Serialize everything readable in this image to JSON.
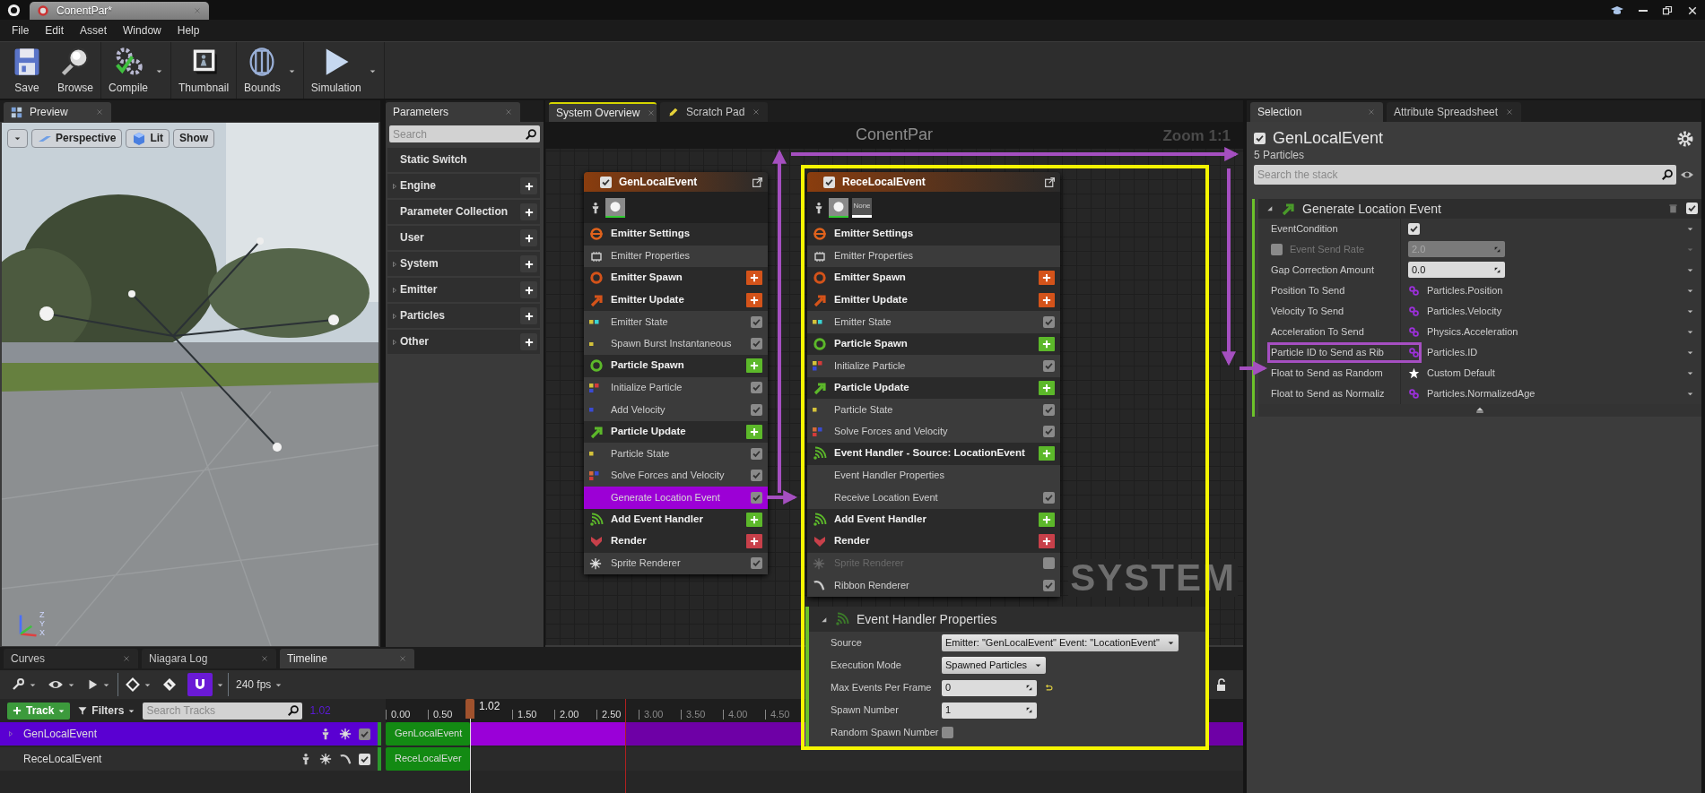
{
  "app_tab": {
    "title": "ConentPar*"
  },
  "menu": [
    "File",
    "Edit",
    "Asset",
    "Window",
    "Help"
  ],
  "toolbar": [
    {
      "label": "Save",
      "kind": "save",
      "dropdown": false
    },
    {
      "label": "Browse",
      "kind": "browse",
      "dropdown": false
    },
    {
      "label": "Compile",
      "kind": "compile",
      "dropdown": true
    },
    {
      "label": "Thumbnail",
      "kind": "thumbnail",
      "dropdown": false
    },
    {
      "label": "Bounds",
      "kind": "bounds",
      "dropdown": true
    },
    {
      "label": "Simulation",
      "kind": "simulation",
      "dropdown": true
    }
  ],
  "preview": {
    "tab": "Preview",
    "buttons": [
      {
        "label": "Perspective",
        "kind": "perspective"
      },
      {
        "label": "Lit",
        "kind": "lit"
      },
      {
        "label": "Show",
        "kind": "show"
      }
    ],
    "axes": [
      "Z",
      "Y",
      "X"
    ]
  },
  "parameters": {
    "tab": "Parameters",
    "placeholder": "Search",
    "items": [
      {
        "label": "Static Switch",
        "expandable": false,
        "addable": false
      },
      {
        "label": "Engine",
        "expandable": true,
        "addable": true
      },
      {
        "label": "Parameter Collection",
        "expandable": false,
        "addable": true
      },
      {
        "label": "User",
        "expandable": false,
        "addable": true
      },
      {
        "label": "System",
        "expandable": true,
        "addable": true
      },
      {
        "label": "Emitter",
        "expandable": true,
        "addable": true
      },
      {
        "label": "Particles",
        "expandable": true,
        "addable": true
      },
      {
        "label": "Other",
        "expandable": true,
        "addable": true
      }
    ]
  },
  "graph": {
    "tabs": [
      {
        "label": "System Overview",
        "kind": "overview",
        "selected": true
      },
      {
        "label": "Scratch Pad",
        "kind": "scratch",
        "selected": false
      }
    ],
    "title": "ConentPar",
    "zoom": "Zoom 1:1",
    "watermark": "SYSTEM",
    "nodes": [
      {
        "title": "GenLocalEvent",
        "enabled": true,
        "rows": [
          {
            "label": "Emitter Settings",
            "kind": "settings",
            "selected": false
          },
          {
            "label": "Emitter Properties",
            "kind": "properties",
            "selected": false
          },
          {
            "label": "Emitter Spawn",
            "kind": "spawn",
            "color": "#d4531a",
            "selected": false
          },
          {
            "label": "Emitter Update",
            "kind": "update",
            "color": "#d4531a",
            "selected": false
          },
          {
            "label": "Emitter State",
            "kind": "module",
            "dots": [
              {
                "color": "#d4c23a"
              },
              {
                "color": "#3ad4d4"
              }
            ],
            "enabled": true,
            "selected": false
          },
          {
            "label": "Spawn Burst Instantaneous",
            "kind": "module",
            "dots": [
              {
                "color": "#d4c23a"
              }
            ],
            "enabled": true,
            "selected": false
          },
          {
            "label": "Particle Spawn",
            "kind": "spawn",
            "color": "#5cb82a",
            "selected": false
          },
          {
            "label": "Initialize Particle",
            "kind": "module",
            "dots": [
              {
                "color": "#d4c23a"
              },
              {
                "color": "#d43a3a"
              },
              {
                "color": "#3a4ad4"
              }
            ],
            "enabled": true,
            "selected": false
          },
          {
            "label": "Add Velocity",
            "kind": "module",
            "dots": [
              {
                "color": "#3a4ad4"
              }
            ],
            "enabled": true,
            "selected": false
          },
          {
            "label": "Particle Update",
            "kind": "update",
            "color": "#5cb82a",
            "selected": false
          },
          {
            "label": "Particle State",
            "kind": "module",
            "dots": [
              {
                "color": "#d4c23a"
              }
            ],
            "enabled": true,
            "selected": false
          },
          {
            "label": "Solve Forces and Velocity",
            "kind": "module",
            "dots": [
              {
                "color": "#d46a3a"
              },
              {
                "color": "#3a4ad4"
              },
              {
                "color": "#d43a3a"
              }
            ],
            "enabled": true,
            "selected": false
          },
          {
            "label": "Generate Location Event",
            "kind": "module",
            "enabled": true,
            "selected": true
          },
          {
            "label": "Add Event Handler",
            "kind": "event",
            "color": "#5cb82a",
            "selected": false
          },
          {
            "label": "Render",
            "kind": "render",
            "color": "#c8404a",
            "selected": false
          },
          {
            "label": "Sprite Renderer",
            "kind": "sprite",
            "enabled": true,
            "selected": false
          }
        ]
      },
      {
        "title": "ReceLocalEvent",
        "enabled": true,
        "thumb_label": "None",
        "rows": [
          {
            "label": "Emitter Settings",
            "kind": "settings",
            "selected": false
          },
          {
            "label": "Emitter Properties",
            "kind": "properties",
            "selected": false
          },
          {
            "label": "Emitter Spawn",
            "kind": "spawn",
            "color": "#d4531a",
            "selected": false
          },
          {
            "label": "Emitter Update",
            "kind": "update",
            "color": "#d4531a",
            "selected": false
          },
          {
            "label": "Emitter State",
            "kind": "module",
            "dots": [
              {
                "color": "#d4c23a"
              },
              {
                "color": "#3ad4d4"
              }
            ],
            "enabled": true,
            "selected": false
          },
          {
            "label": "Particle Spawn",
            "kind": "spawn",
            "color": "#5cb82a",
            "selected": false
          },
          {
            "label": "Initialize Particle",
            "kind": "module",
            "dots": [
              {
                "color": "#d4c23a"
              },
              {
                "color": "#d43a3a"
              },
              {
                "color": "#3a4ad4"
              }
            ],
            "enabled": true,
            "selected": false
          },
          {
            "label": "Particle Update",
            "kind": "update",
            "color": "#5cb82a",
            "selected": false
          },
          {
            "label": "Particle State",
            "kind": "module",
            "dots": [
              {
                "color": "#d4c23a"
              }
            ],
            "enabled": true,
            "selected": false
          },
          {
            "label": "Solve Forces and Velocity",
            "kind": "module",
            "dots": [
              {
                "color": "#d46a3a"
              },
              {
                "color": "#3a4ad4"
              },
              {
                "color": "#d43a3a"
              }
            ],
            "enabled": true,
            "selected": false
          },
          {
            "label": "Event Handler - Source: LocationEvent",
            "kind": "event",
            "color": "#5cb82a",
            "selected": false
          },
          {
            "label": "Event Handler Properties",
            "kind": "plain",
            "selected": false
          },
          {
            "label": "Receive Location Event",
            "kind": "module",
            "enabled": true,
            "selected": false
          },
          {
            "label": "Add Event Handler",
            "kind": "event",
            "color": "#5cb82a",
            "selected": false
          },
          {
            "label": "Render",
            "kind": "render",
            "color": "#c8404a",
            "selected": false
          },
          {
            "label": "Sprite Renderer",
            "kind": "sprite",
            "enabled": false,
            "selected": false
          },
          {
            "label": "Ribbon Renderer",
            "kind": "ribbon",
            "enabled": true,
            "selected": false
          }
        ]
      }
    ]
  },
  "event_handler_panel": {
    "title": "Event Handler Properties",
    "expanded": true,
    "rows": [
      {
        "label": "Source",
        "kind": "dropdown",
        "value": "Emitter: \"GenLocalEvent\" Event: \"LocationEvent\""
      },
      {
        "label": "Execution Mode",
        "kind": "dropdown",
        "value": "Spawned Particles"
      },
      {
        "label": "Max Events Per Frame",
        "kind": "number",
        "value": "0",
        "reset": true
      },
      {
        "label": "Spawn Number",
        "kind": "number",
        "value": "1",
        "reset": false
      },
      {
        "label": "Random Spawn Number",
        "kind": "checkbox",
        "checked": false
      }
    ]
  },
  "selection": {
    "tabs": [
      {
        "label": "Selection",
        "selected": true
      },
      {
        "label": "Attribute Spreadsheet",
        "selected": false
      }
    ],
    "emitter": {
      "title": "GenLocalEvent",
      "enabled": true
    },
    "count": "5 Particles",
    "placeholder": "Search the stack",
    "section": {
      "title": "Generate Location Event",
      "expanded": true,
      "enabled": true,
      "rows": [
        {
          "label": "EventCondition",
          "kind": "checkbox",
          "checked": true,
          "disabled": false,
          "highlighted": false
        },
        {
          "label": "Event Send Rate",
          "kind": "number",
          "value": "2.0",
          "edit_condition": false,
          "disabled": true,
          "highlighted": false
        },
        {
          "label": "Gap Correction Amount",
          "kind": "number",
          "value": "0.0",
          "disabled": false,
          "highlighted": false
        },
        {
          "label": "Position To Send",
          "kind": "binding",
          "value": "Particles.Position",
          "disabled": false,
          "highlighted": false
        },
        {
          "label": "Velocity To Send",
          "kind": "binding",
          "value": "Particles.Velocity",
          "disabled": false,
          "highlighted": false
        },
        {
          "label": "Acceleration To Send",
          "kind": "binding",
          "value": "Physics.Acceleration",
          "disabled": false,
          "highlighted": false
        },
        {
          "label": "Particle ID to Send as Rib",
          "kind": "binding",
          "value": "Particles.ID",
          "disabled": false,
          "highlighted": true
        },
        {
          "label": "Float to Send as Random",
          "kind": "default",
          "value": "Custom Default",
          "disabled": false,
          "highlighted": false
        },
        {
          "label": "Float to Send as Normaliz",
          "kind": "binding",
          "value": "Particles.NormalizedAge",
          "disabled": false,
          "highlighted": false
        }
      ]
    }
  },
  "timeline": {
    "tabs": [
      {
        "label": "Curves",
        "selected": false
      },
      {
        "label": "Niagara Log",
        "selected": false
      },
      {
        "label": "Timeline",
        "selected": true
      }
    ],
    "snap_on": true,
    "fps": "240 fps",
    "track_button": "Track",
    "filters": "Filters",
    "placeholder": "Search Tracks",
    "time_readout": "1.02",
    "ruler": [
      {
        "label": "0.00",
        "kind": "tick",
        "in_range": true
      },
      {
        "label": "0.50",
        "kind": "tick",
        "in_range": true
      },
      {
        "label": "1.02",
        "kind": "playhead"
      },
      {
        "label": "1.50",
        "kind": "tick",
        "in_range": true
      },
      {
        "label": "2.00",
        "kind": "tick",
        "in_range": true
      },
      {
        "label": "2.50",
        "kind": "tick",
        "in_range": true
      },
      {
        "label": "3.00",
        "kind": "tick",
        "in_range": false
      },
      {
        "label": "3.50",
        "kind": "tick",
        "in_range": false
      },
      {
        "label": "4.00",
        "kind": "tick",
        "in_range": false
      },
      {
        "label": "4.50",
        "kind": "tick",
        "in_range": false
      }
    ],
    "tracks": [
      {
        "name": "GenLocalEvent",
        "selected": true,
        "enabled": true,
        "renderers": [
          {
            "kind": "sprite"
          }
        ],
        "clip": "GenLocalEvent"
      },
      {
        "name": "ReceLocalEvent",
        "selected": false,
        "enabled": true,
        "renderers": [
          {
            "kind": "sprite"
          },
          {
            "kind": "ribbon"
          }
        ],
        "clip": "ReceLocalEver"
      }
    ]
  }
}
